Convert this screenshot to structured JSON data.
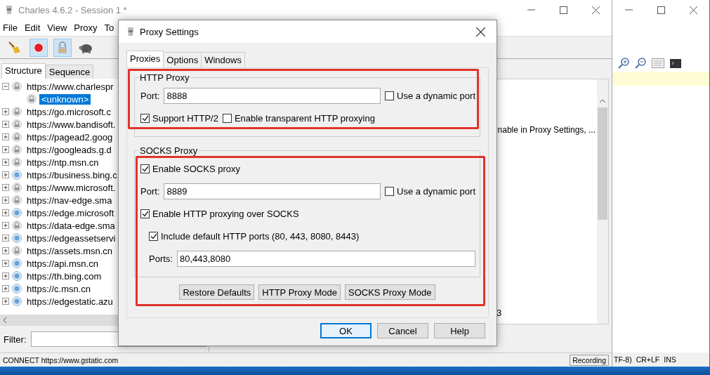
{
  "main_window": {
    "title": "Charles 4.6.2 - Session 1 *"
  },
  "menu": [
    "File",
    "Edit",
    "View",
    "Proxy",
    "To"
  ],
  "toolbar": [
    {
      "kind": "broom",
      "selected": false
    },
    {
      "kind": "record",
      "selected": true
    },
    {
      "kind": "throttle",
      "selected": true
    },
    {
      "kind": "turtle",
      "selected": false
    }
  ],
  "tabs": [
    {
      "label": "Structure",
      "selected": true
    },
    {
      "label": "Sequence",
      "selected": false
    }
  ],
  "tree": [
    {
      "label": "https://www.charlespr",
      "kind": "locked",
      "expanded": true,
      "selected": false,
      "children": [
        {
          "label": "<unknown>",
          "kind": "locked",
          "selected": true
        }
      ]
    },
    {
      "label": "https://go.microsoft.c",
      "kind": "locked",
      "expanded": false,
      "selected": false
    },
    {
      "label": "https://www.bandisoft.",
      "kind": "locked",
      "expanded": false,
      "selected": false
    },
    {
      "label": "https://pagead2.goog",
      "kind": "locked",
      "expanded": false,
      "selected": false
    },
    {
      "label": "https://googleads.g.d",
      "kind": "locked",
      "expanded": false,
      "selected": false
    },
    {
      "label": "https://ntp.msn.cn",
      "kind": "locked",
      "expanded": false,
      "selected": false
    },
    {
      "label": "https://business.bing.c",
      "kind": "open",
      "expanded": false,
      "selected": false
    },
    {
      "label": "https://www.microsoft.",
      "kind": "locked",
      "expanded": false,
      "selected": false
    },
    {
      "label": "https://nav-edge.sma",
      "kind": "locked",
      "expanded": false,
      "selected": false
    },
    {
      "label": "https://edge.microsoft",
      "kind": "open",
      "expanded": false,
      "selected": false
    },
    {
      "label": "https://data-edge.sma",
      "kind": "locked",
      "expanded": false,
      "selected": false
    },
    {
      "label": "https://edgeassetservi",
      "kind": "open",
      "expanded": false,
      "selected": false
    },
    {
      "label": "https://assets.msn.cn",
      "kind": "locked",
      "expanded": false,
      "selected": false
    },
    {
      "label": "https://api.msn.cn",
      "kind": "open",
      "expanded": false,
      "selected": false
    },
    {
      "label": "https://th.bing.com",
      "kind": "open",
      "expanded": false,
      "selected": false
    },
    {
      "label": "https://c.msn.cn",
      "kind": "open",
      "expanded": false,
      "selected": false
    },
    {
      "label": "https://edgestatic.azu",
      "kind": "open",
      "expanded": false,
      "selected": false
    }
  ],
  "filter": {
    "label": "Filter:"
  },
  "detail": {
    "line_1": "nable in Proxy Settings, ...",
    "line_2": "3"
  },
  "status_bar": {
    "text": "CONNECT https://www.gstatic.com",
    "recording": "Recording",
    "fields": [
      "TF-8)",
      "CR+LF",
      "INS"
    ]
  },
  "dialog": {
    "title": "Proxy Settings",
    "tabs": [
      {
        "label": "Proxies",
        "selected": true
      },
      {
        "label": "Options",
        "selected": false
      },
      {
        "label": "Windows",
        "selected": false
      }
    ],
    "http_proxy": {
      "legend": "HTTP Proxy",
      "port_label": "Port:",
      "port": "8888",
      "dynamic_port": {
        "label": "Use a dynamic port",
        "checked": false
      },
      "options": [
        {
          "label": "Support HTTP/2",
          "checked": true
        },
        {
          "label": "Enable transparent HTTP proxying",
          "checked": false
        }
      ]
    },
    "socks_proxy": {
      "legend": "SOCKS Proxy",
      "enable": {
        "label": "Enable SOCKS proxy",
        "checked": true
      },
      "port_label": "Port:",
      "port": "8889",
      "dynamic_port": {
        "label": "Use a dynamic port",
        "checked": false
      },
      "http_over_socks": {
        "label": "Enable HTTP proxying over SOCKS",
        "checked": true
      },
      "include_default": {
        "label": "Include default HTTP ports (80, 443, 8080, 8443)",
        "checked": true
      },
      "ports_label": "Ports:",
      "ports": "80,443,8080"
    },
    "mode_buttons": [
      "Restore Defaults",
      "HTTP Proxy Mode",
      "SOCKS Proxy Mode"
    ],
    "buttons": [
      {
        "label": "OK",
        "default": true
      },
      {
        "label": "Cancel",
        "default": false
      },
      {
        "label": "Help",
        "default": false
      }
    ]
  }
}
